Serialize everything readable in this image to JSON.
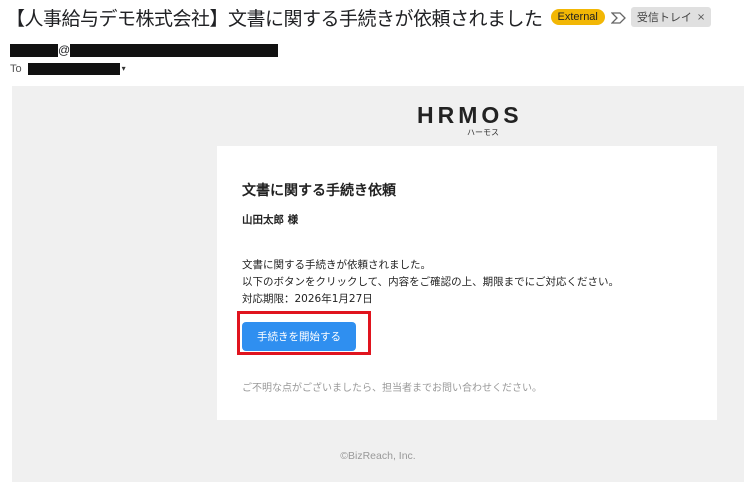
{
  "email": {
    "subject": "【人事給与デモ株式会社】文書に関する手続きが依頼されました",
    "external_badge": "External",
    "label_chip": "受信トレイ",
    "label_close": "×",
    "sender_at": "@",
    "to_label": "To",
    "to_caret": "▾"
  },
  "brand": {
    "logo": "HRMOS",
    "logo_sub": "ハーモス"
  },
  "card": {
    "title": "文書に関する手続き依頼",
    "recipient": "山田太郎 様",
    "line1": "文書に関する手続きが依頼されました。",
    "line2": "以下のボタンをクリックして、内容をご確認の上、期限までにご対応ください。",
    "deadline": "対応期限：2026年1月27日",
    "button_label": "手続きを開始する",
    "note": "ご不明な点がございましたら、担当者までお問い合わせください。"
  },
  "footer": {
    "copyright": "©BizReach, Inc."
  },
  "colors": {
    "accent_button": "#2f8ff0",
    "highlight_border": "#e0141e",
    "external_badge": "#f2b705"
  }
}
